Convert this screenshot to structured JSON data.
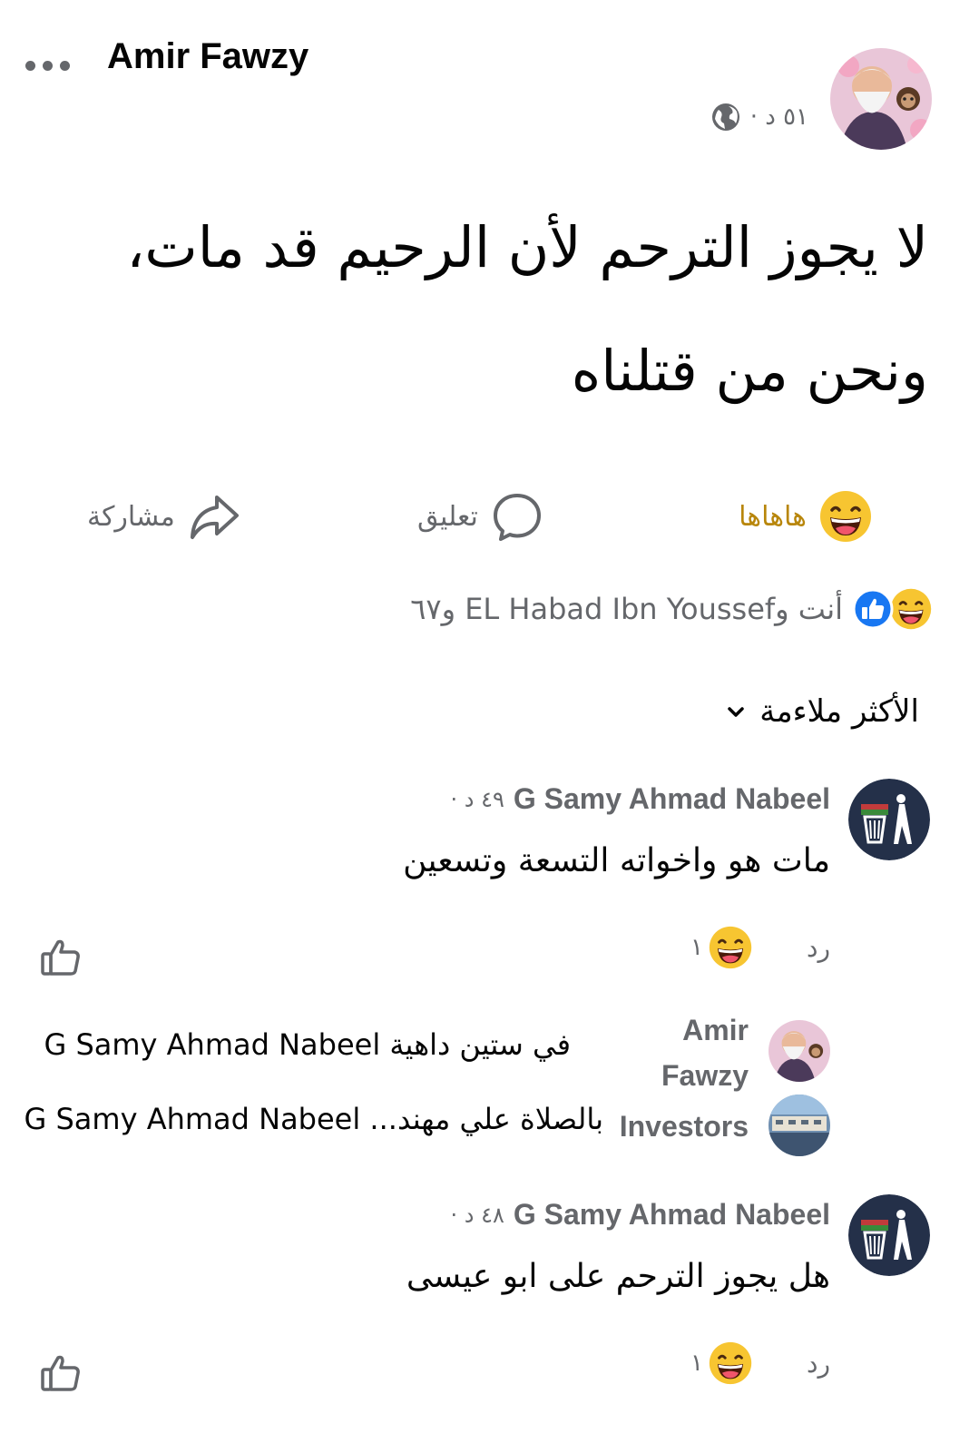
{
  "post": {
    "author": "Amir Fawzy",
    "time": "٥١ د ·",
    "text": "لا يجوز الترحم لأن الرحيم قد مات، ونحن من قتلناه"
  },
  "actions": {
    "react_label": "هاهاها",
    "comment_label": "تعليق",
    "share_label": "مشاركة"
  },
  "reactions": {
    "summary": "أنت وEL Habad Ibn Youssef و٦٧"
  },
  "sort": {
    "label": "الأكثر ملاءمة"
  },
  "comments": [
    {
      "name": "G Samy Ahmad Nabeel",
      "time": "٤٩ د ·",
      "text": "مات هو واخواته التسعة وتسعين",
      "reply_label": "رد",
      "reaction_count": "١"
    },
    {
      "name": "G Samy Ahmad Nabeel",
      "time": "٤٨ د ·",
      "text": "هل يجوز الترحم على ابو عيسى",
      "reply_label": "رد",
      "reaction_count": "١"
    }
  ],
  "replies": [
    {
      "name": "Amir Fawzy",
      "text": "في ستين داهية G Samy Ahmad Nabeel"
    },
    {
      "name": "Investors",
      "text": "بالصلاة علي مهند... G Samy Ahmad Nabeel"
    }
  ],
  "colors": {
    "secondary_text": "#65676b",
    "haha_label": "#b8860b",
    "like_blue": "#1877f2",
    "emoji_yellow": "#f7c531"
  },
  "icons": [
    "more-icon",
    "globe-icon",
    "haha-icon",
    "comment-icon",
    "share-icon",
    "like-icon",
    "chevron-down-icon",
    "like-outline-icon"
  ]
}
